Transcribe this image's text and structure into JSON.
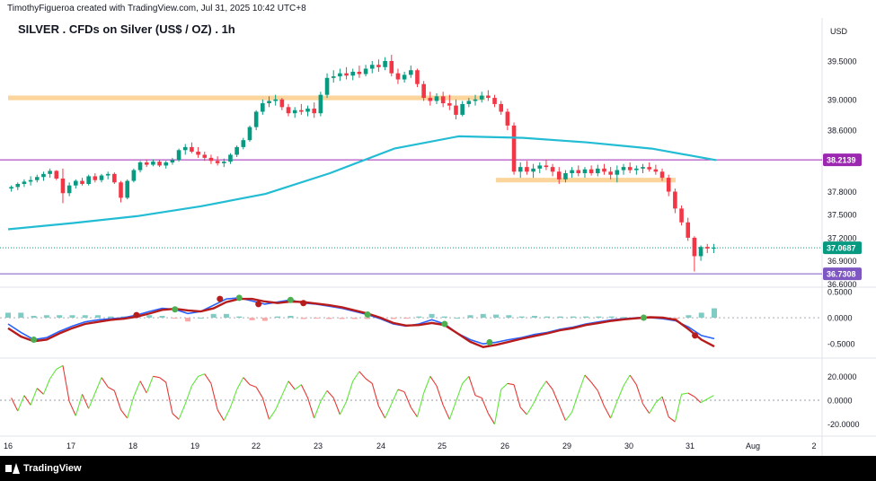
{
  "header": {
    "credit": "TimothyFigueroa created with TradingView.com, Jul 31, 2025 10:42 UTC+8",
    "title": "SILVER . CFDs on Silver (US$ / OZ) . 1h"
  },
  "footer": {
    "brand": "TradingView"
  },
  "colors": {
    "up": "#089981",
    "down": "#f23645",
    "ma": "#22bcd4",
    "zone": "#fbd090",
    "resistance": "#9c27b0",
    "support": "#7e57c2",
    "macd": "#2962ff",
    "signal": "#b71c1c",
    "cross_up": "#4caf50",
    "cross_down": "#b71c1c",
    "osc_up": "#5ee63a",
    "osc_down": "#e53935"
  },
  "chart_data": [
    {
      "type": "candlestick",
      "title": "SILVER . CFDs on Silver (US$ / OZ) . 1h",
      "currency": "USD",
      "x_ticks": [
        "16",
        "17",
        "18",
        "19",
        "22",
        "23",
        "24",
        "25",
        "26",
        "29",
        "30",
        "31",
        "Aug",
        "2"
      ],
      "y_ticks": [
        "39.5000",
        "39.0000",
        "38.6000",
        "38.2000",
        "37.8000",
        "37.5000",
        "37.2000",
        "36.9000",
        "36.6000"
      ],
      "ylim": [
        36.58,
        39.78
      ],
      "price_labels": [
        {
          "value": 38.2139,
          "text": "38.2139"
        },
        {
          "value": 37.0687,
          "text": "37.0687"
        },
        {
          "value": 36.7308,
          "text": "36.7308"
        }
      ],
      "horizontal_lines": [
        {
          "value": 38.2139,
          "role": "resistance"
        },
        {
          "value": 37.0687,
          "role": "last price"
        },
        {
          "value": 36.7308,
          "role": "support"
        }
      ],
      "zones": [
        {
          "from": "16",
          "to": "25",
          "low": 38.99,
          "high": 39.05
        },
        {
          "from": "26",
          "to": "31",
          "low": 37.92,
          "high": 37.98
        }
      ],
      "moving_average": [
        {
          "x": 0,
          "v": 37.31
        },
        {
          "x": 1,
          "v": 37.39
        },
        {
          "x": 2,
          "v": 37.48
        },
        {
          "x": 3,
          "v": 37.61
        },
        {
          "x": 4,
          "v": 37.77
        },
        {
          "x": 5,
          "v": 38.04
        },
        {
          "x": 6,
          "v": 38.36
        },
        {
          "x": 7,
          "v": 38.52
        },
        {
          "x": 8,
          "v": 38.5
        },
        {
          "x": 9,
          "v": 38.44
        },
        {
          "x": 10,
          "v": 38.36
        },
        {
          "x": 11,
          "v": 38.21
        }
      ],
      "candles": [
        [
          37.84,
          37.88,
          37.8,
          37.86
        ],
        [
          37.86,
          37.92,
          37.82,
          37.9
        ],
        [
          37.9,
          37.96,
          37.86,
          37.93
        ],
        [
          37.93,
          38.0,
          37.88,
          37.95
        ],
        [
          37.95,
          38.02,
          37.92,
          37.99
        ],
        [
          37.99,
          38.06,
          37.94,
          38.03
        ],
        [
          38.03,
          38.1,
          37.98,
          38.07
        ],
        [
          38.07,
          38.08,
          37.95,
          37.97
        ],
        [
          37.97,
          38.1,
          37.65,
          37.78
        ],
        [
          37.78,
          37.92,
          37.74,
          37.88
        ],
        [
          37.88,
          37.96,
          37.84,
          37.94
        ],
        [
          37.94,
          37.98,
          37.88,
          37.9
        ],
        [
          37.9,
          38.02,
          37.88,
          38.0
        ],
        [
          38.0,
          38.04,
          37.92,
          37.95
        ],
        [
          37.95,
          38.03,
          37.92,
          38.01
        ],
        [
          38.01,
          38.06,
          37.96,
          38.03
        ],
        [
          38.03,
          38.05,
          37.9,
          37.92
        ],
        [
          37.92,
          37.94,
          37.66,
          37.72
        ],
        [
          37.72,
          37.96,
          37.7,
          37.94
        ],
        [
          37.94,
          38.1,
          37.92,
          38.08
        ],
        [
          38.08,
          38.2,
          38.05,
          38.18
        ],
        [
          38.18,
          38.22,
          38.12,
          38.15
        ],
        [
          38.15,
          38.22,
          38.13,
          38.19
        ],
        [
          38.19,
          38.21,
          38.12,
          38.14
        ],
        [
          38.14,
          38.2,
          38.1,
          38.18
        ],
        [
          38.18,
          38.24,
          38.15,
          38.21
        ],
        [
          38.21,
          38.36,
          38.19,
          38.34
        ],
        [
          38.34,
          38.42,
          38.28,
          38.38
        ],
        [
          38.38,
          38.44,
          38.3,
          38.32
        ],
        [
          38.32,
          38.38,
          38.24,
          38.28
        ],
        [
          38.28,
          38.32,
          38.2,
          38.24
        ],
        [
          38.24,
          38.28,
          38.16,
          38.2
        ],
        [
          38.2,
          38.26,
          38.14,
          38.17
        ],
        [
          38.17,
          38.23,
          38.12,
          38.19
        ],
        [
          38.19,
          38.3,
          38.16,
          38.28
        ],
        [
          38.28,
          38.4,
          38.25,
          38.38
        ],
        [
          38.38,
          38.5,
          38.35,
          38.47
        ],
        [
          38.47,
          38.66,
          38.45,
          38.64
        ],
        [
          38.64,
          38.86,
          38.6,
          38.84
        ],
        [
          38.84,
          39.0,
          38.8,
          38.95
        ],
        [
          38.95,
          39.04,
          38.9,
          38.98
        ],
        [
          38.98,
          39.06,
          38.92,
          39.0
        ],
        [
          39.0,
          39.02,
          38.86,
          38.9
        ],
        [
          38.9,
          38.94,
          38.78,
          38.82
        ],
        [
          38.82,
          38.9,
          38.76,
          38.86
        ],
        [
          38.86,
          38.94,
          38.8,
          38.84
        ],
        [
          38.84,
          38.92,
          38.78,
          38.88
        ],
        [
          38.88,
          38.96,
          38.76,
          38.82
        ],
        [
          38.82,
          39.1,
          38.78,
          39.06
        ],
        [
          39.06,
          39.34,
          39.02,
          39.28
        ],
        [
          39.28,
          39.38,
          39.22,
          39.3
        ],
        [
          39.3,
          39.4,
          39.24,
          39.34
        ],
        [
          39.34,
          39.42,
          39.26,
          39.31
        ],
        [
          39.31,
          39.4,
          39.25,
          39.36
        ],
        [
          39.36,
          39.44,
          39.28,
          39.33
        ],
        [
          39.33,
          39.45,
          39.3,
          39.4
        ],
        [
          39.4,
          39.5,
          39.34,
          39.45
        ],
        [
          39.45,
          39.52,
          39.36,
          39.42
        ],
        [
          39.42,
          39.55,
          39.38,
          39.5
        ],
        [
          39.5,
          39.58,
          39.3,
          39.34
        ],
        [
          39.34,
          39.4,
          39.2,
          39.26
        ],
        [
          39.26,
          39.36,
          39.22,
          39.32
        ],
        [
          39.32,
          39.44,
          39.28,
          39.38
        ],
        [
          39.38,
          39.4,
          39.16,
          39.2
        ],
        [
          39.2,
          39.24,
          38.98,
          39.02
        ],
        [
          39.02,
          39.1,
          38.92,
          38.98
        ],
        [
          38.98,
          39.08,
          38.94,
          39.04
        ],
        [
          39.04,
          39.1,
          38.9,
          38.95
        ],
        [
          38.95,
          39.06,
          38.86,
          38.92
        ],
        [
          38.92,
          39.0,
          38.74,
          38.8
        ],
        [
          38.8,
          38.98,
          38.78,
          38.94
        ],
        [
          38.94,
          39.02,
          38.9,
          38.98
        ],
        [
          38.98,
          39.06,
          38.92,
          39.0
        ],
        [
          39.0,
          39.1,
          38.96,
          39.05
        ],
        [
          39.05,
          39.12,
          38.98,
          39.02
        ],
        [
          39.02,
          39.06,
          38.9,
          38.94
        ],
        [
          38.94,
          38.98,
          38.8,
          38.84
        ],
        [
          38.84,
          38.88,
          38.6,
          38.66
        ],
        [
          38.66,
          38.7,
          38.02,
          38.06
        ],
        [
          38.06,
          38.18,
          37.98,
          38.12
        ],
        [
          38.12,
          38.2,
          38.02,
          38.06
        ],
        [
          38.06,
          38.16,
          37.98,
          38.1
        ],
        [
          38.1,
          38.18,
          38.04,
          38.14
        ],
        [
          38.14,
          38.22,
          38.08,
          38.12
        ],
        [
          38.12,
          38.16,
          38.0,
          38.06
        ],
        [
          38.06,
          38.12,
          37.9,
          37.96
        ],
        [
          37.96,
          38.08,
          37.92,
          38.04
        ],
        [
          38.04,
          38.12,
          37.98,
          38.08
        ],
        [
          38.08,
          38.14,
          38.0,
          38.04
        ],
        [
          38.04,
          38.12,
          37.98,
          38.09
        ],
        [
          38.09,
          38.14,
          38.01,
          38.04
        ],
        [
          38.04,
          38.15,
          38.0,
          38.1
        ],
        [
          38.1,
          38.16,
          38.02,
          38.06
        ],
        [
          38.06,
          38.12,
          37.96,
          38.02
        ],
        [
          38.02,
          38.14,
          37.92,
          38.08
        ],
        [
          38.08,
          38.16,
          38.02,
          38.12
        ],
        [
          38.12,
          38.18,
          38.04,
          38.08
        ],
        [
          38.08,
          38.14,
          38.02,
          38.1
        ],
        [
          38.1,
          38.16,
          38.04,
          38.12
        ],
        [
          38.12,
          38.18,
          38.06,
          38.09
        ],
        [
          38.09,
          38.15,
          38.02,
          38.06
        ],
        [
          38.06,
          38.1,
          37.94,
          37.98
        ],
        [
          37.98,
          38.02,
          37.74,
          37.8
        ],
        [
          37.8,
          37.84,
          37.52,
          37.58
        ],
        [
          37.58,
          37.62,
          37.36,
          37.4
        ],
        [
          37.4,
          37.46,
          37.16,
          37.2
        ],
        [
          37.2,
          37.22,
          36.76,
          36.96
        ],
        [
          36.96,
          37.1,
          36.9,
          37.08
        ],
        [
          37.08,
          37.12,
          37.0,
          37.06
        ],
        [
          37.06,
          37.12,
          37.0,
          37.07
        ]
      ]
    },
    {
      "type": "line",
      "name": "MACD",
      "y_ticks": [
        "0.5000",
        "0.0000",
        "-0.5000"
      ],
      "ylim": [
        -0.72,
        0.55
      ],
      "x": [
        0,
        2,
        4,
        6,
        8,
        10,
        12,
        14,
        16,
        18,
        20,
        22,
        24,
        26,
        28,
        30,
        32,
        34,
        36,
        38,
        40,
        42,
        44,
        46,
        48,
        50,
        52,
        54,
        56,
        58,
        60,
        62,
        64,
        66,
        68,
        70,
        72,
        74,
        76,
        78,
        80,
        82,
        84,
        86,
        88,
        90,
        92,
        94,
        96,
        98,
        100,
        102,
        104,
        106,
        108,
        110
      ],
      "series": [
        {
          "role": "macd",
          "values": [
            -0.12,
            -0.28,
            -0.42,
            -0.38,
            -0.26,
            -0.16,
            -0.08,
            -0.04,
            -0.02,
            0.0,
            0.05,
            0.12,
            0.18,
            0.16,
            0.08,
            0.12,
            0.24,
            0.36,
            0.38,
            0.32,
            0.26,
            0.3,
            0.34,
            0.28,
            0.26,
            0.22,
            0.18,
            0.12,
            0.06,
            -0.02,
            -0.12,
            -0.16,
            -0.12,
            -0.04,
            -0.12,
            -0.3,
            -0.42,
            -0.5,
            -0.47,
            -0.42,
            -0.38,
            -0.32,
            -0.28,
            -0.22,
            -0.18,
            -0.12,
            -0.08,
            -0.04,
            -0.02,
            0.0,
            0.0,
            -0.02,
            -0.06,
            -0.18,
            -0.34,
            -0.4
          ]
        },
        {
          "role": "signal",
          "values": [
            -0.2,
            -0.36,
            -0.45,
            -0.42,
            -0.3,
            -0.2,
            -0.12,
            -0.08,
            -0.04,
            -0.02,
            0.02,
            0.08,
            0.15,
            0.17,
            0.14,
            0.12,
            0.18,
            0.3,
            0.36,
            0.36,
            0.31,
            0.28,
            0.31,
            0.3,
            0.27,
            0.24,
            0.2,
            0.14,
            0.08,
            0.0,
            -0.1,
            -0.15,
            -0.14,
            -0.1,
            -0.14,
            -0.3,
            -0.46,
            -0.56,
            -0.52,
            -0.46,
            -0.4,
            -0.35,
            -0.3,
            -0.24,
            -0.2,
            -0.14,
            -0.1,
            -0.06,
            -0.03,
            -0.01,
            0.01,
            0.0,
            -0.04,
            -0.22,
            -0.42,
            -0.55
          ]
        }
      ],
      "cross_markers": [
        {
          "x": 8,
          "type": "bullish"
        },
        {
          "x": 40,
          "type": "bearish"
        },
        {
          "x": 52,
          "type": "bullish"
        },
        {
          "x": 66,
          "type": "bearish"
        },
        {
          "x": 72,
          "type": "bullish"
        },
        {
          "x": 78,
          "type": "bearish"
        },
        {
          "x": 88,
          "type": "bullish"
        },
        {
          "x": 92,
          "type": "bearish"
        },
        {
          "x": 112,
          "type": "bullish"
        },
        {
          "x": 136,
          "type": "bullish"
        },
        {
          "x": 150,
          "type": "bullish"
        },
        {
          "x": 198,
          "type": "bullish"
        },
        {
          "x": 214,
          "type": "bearish"
        }
      ]
    },
    {
      "type": "line",
      "name": "Oscillator",
      "y_ticks": [
        "20.0000",
        "0.0000",
        "-20.0000"
      ],
      "ylim": [
        -27,
        33
      ],
      "values": [
        2,
        -9,
        4,
        -4,
        10,
        5,
        18,
        26,
        29,
        -1,
        -13,
        5,
        -7,
        6,
        19,
        11,
        8,
        -8,
        -15,
        3,
        16,
        6,
        20,
        19,
        15,
        -11,
        -16,
        -3,
        12,
        20,
        22,
        14,
        -8,
        -17,
        -6,
        9,
        19,
        13,
        11,
        2,
        -16,
        -8,
        4,
        16,
        9,
        13,
        2,
        -15,
        -1,
        8,
        2,
        -12,
        -1,
        16,
        24,
        18,
        14,
        -5,
        -15,
        -3,
        9,
        7,
        -6,
        -14,
        6,
        20,
        12,
        -4,
        -16,
        -1,
        14,
        20,
        4,
        2,
        -11,
        -20,
        9,
        14,
        13,
        -6,
        -12,
        -3,
        8,
        16,
        9,
        -4,
        -17,
        -10,
        6,
        21,
        15,
        8,
        -5,
        -15,
        -1,
        12,
        21,
        13,
        -3,
        -11,
        -2,
        3,
        -14,
        -18,
        5,
        6,
        3,
        -2,
        1,
        4
      ],
      "zero_line": true
    }
  ]
}
